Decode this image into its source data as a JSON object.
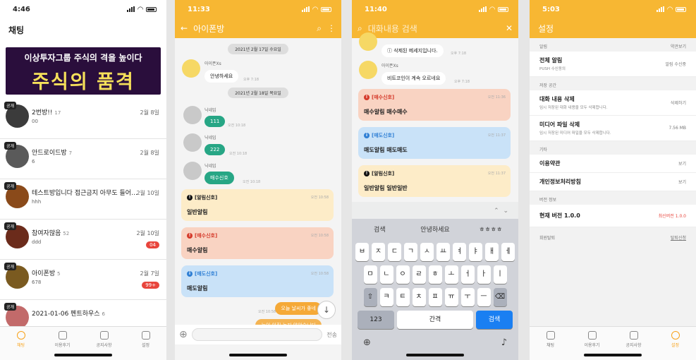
{
  "s1": {
    "time": "4:46",
    "title": "채팅",
    "banner_top": "이상투자그룹 주식의 격을 높이다",
    "banner_main": "주식의 품격",
    "rooms": [
      {
        "tag": "공개",
        "name": "2번방!!",
        "count": "17",
        "msg": "00",
        "date": "2월 8일",
        "badge": ""
      },
      {
        "tag": "공개",
        "name": "안드로이드방",
        "count": "7",
        "msg": "6",
        "date": "2월 8일",
        "badge": ""
      },
      {
        "tag": "공개",
        "name": "테스트방입니다 접근금지 아무도 들어…",
        "count": "8",
        "msg": "hhh",
        "date": "2월 10일",
        "badge": ""
      },
      {
        "tag": "공개",
        "name": "참여자많음",
        "count": "52",
        "msg": "ddd",
        "date": "2월 10일",
        "badge": "04"
      },
      {
        "tag": "공개",
        "name": "아이폰방",
        "count": "5",
        "msg": "678",
        "date": "2월 7일",
        "badge": "99+"
      },
      {
        "tag": "공개",
        "name": "2021-01-06 펜트하우스",
        "count": "6",
        "msg": "",
        "date": "",
        "badge": ""
      }
    ],
    "tabs": [
      "채팅",
      "이용후기",
      "공지사항",
      "설정"
    ]
  },
  "s2": {
    "time": "11:33",
    "title": "아이폰방",
    "date1": "2021년 2월 17일 수요일",
    "bot_name": "아이폰Xs",
    "bot_msg": "안녕하세요",
    "bot_time": "오후 7:18",
    "date2": "2021년 2월 18일 목요일",
    "nick": "닉네임",
    "m1": "111",
    "m2": "222",
    "m3": "매수신호",
    "mt": "오전 10:18",
    "cards": [
      {
        "head": "[알림신호]",
        "body": "일반알림",
        "time": "오전 10:58"
      },
      {
        "head": "[매수신호]",
        "body": "매수알림",
        "time": "오전 10:58"
      },
      {
        "head": "[매도신호]",
        "body": "매도알림",
        "time": "오전 10:58"
      }
    ],
    "my1": "오늘 날씨가 좋네",
    "my2": "눈이 아직 녹지 않았습니다",
    "my_time": "오전 10:58",
    "send": "전송"
  },
  "s3": {
    "time": "11:40",
    "search": "대화내용 검색",
    "del_msg": "삭제된 메세지입니다.",
    "del_time": "오후 7:18",
    "bot_name": "아이폰Xs",
    "bot_msg": "비트코인이 계속 오르네요",
    "bot_time": "오후 7:18",
    "cards": [
      {
        "head": "[매수신호]",
        "body": "매수알림 매수매수",
        "time": "오전 11:36"
      },
      {
        "head": "[매도신호]",
        "body": "매도알림 매도매도",
        "time": "오전 11:37"
      },
      {
        "head": "[알림신호]",
        "body": "일반알림 일반일반",
        "time": "오전 11:37"
      }
    ],
    "sugg": [
      "검색",
      "안녕하세요",
      "ㅎㅎㅎㅎ"
    ],
    "row1": [
      "ㅂ",
      "ㅈ",
      "ㄷ",
      "ㄱ",
      "ㅅ",
      "ㅛ",
      "ㅕ",
      "ㅑ",
      "ㅐ",
      "ㅔ"
    ],
    "row2": [
      "ㅁ",
      "ㄴ",
      "ㅇ",
      "ㄹ",
      "ㅎ",
      "ㅗ",
      "ㅓ",
      "ㅏ",
      "ㅣ"
    ],
    "row3": [
      "ㅋ",
      "ㅌ",
      "ㅊ",
      "ㅍ",
      "ㅠ",
      "ㅜ",
      "ㅡ"
    ],
    "k123": "123",
    "space": "간격",
    "go": "검색"
  },
  "s4": {
    "time": "5:03",
    "title": "설정",
    "sec1": "알림",
    "terms": "약관보기",
    "push": "전체 알림",
    "push_sub": "PUSH 수신동의",
    "push_val": "알림 수신중",
    "sec2": "저장 공간",
    "del": "대화 내용 삭제",
    "del_sub": "임시 저장된 대화 내용을 모두 삭제합니다.",
    "del_val": "삭제하기",
    "media": "미디어 파일 삭제",
    "media_sub": "임시 저장된 미디어 파일을 모두 삭제합니다.",
    "media_val": "7.56 MB",
    "sec3": "기타",
    "tos": "이용약관",
    "view": "보기",
    "privacy": "개인정보처리방침",
    "view2": "보기",
    "sec4": "버전 정보",
    "ver": "현재 버전 1.0.0",
    "latest": "최신버전 1.0.0",
    "sec5": "회원탈퇴",
    "quit": "탈퇴신청"
  }
}
